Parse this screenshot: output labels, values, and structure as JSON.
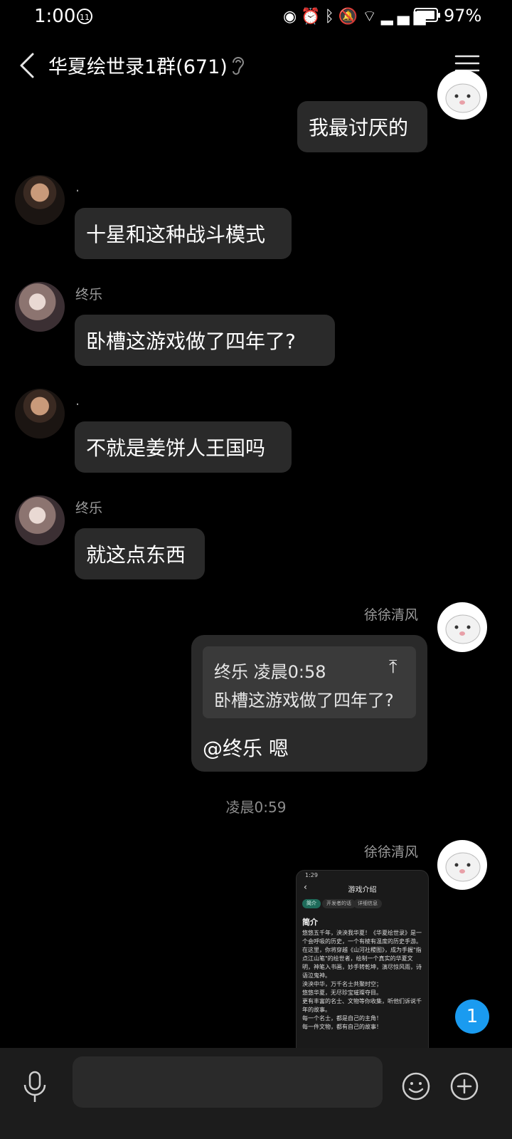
{
  "status_bar": {
    "time": "1:00",
    "badge": "11",
    "battery": "97%",
    "battery_level": 0.97
  },
  "header": {
    "title": "华夏绘世录1群(671)"
  },
  "messages": [
    {
      "side": "right",
      "text": "我最讨厌的"
    },
    {
      "side": "left",
      "sender": ".",
      "text": "十星和这种战斗模式"
    },
    {
      "side": "left",
      "sender": "终乐",
      "text": "卧槽这游戏做了四年了?"
    },
    {
      "side": "left",
      "sender": ".",
      "text": "不就是姜饼人王国吗"
    },
    {
      "side": "left",
      "sender": "终乐",
      "text": "就这点东西"
    },
    {
      "side": "right",
      "sender": "徐徐清风",
      "quote": {
        "author": "终乐",
        "time": "凌晨0:58",
        "text": "卧槽这游戏做了四年了?"
      },
      "text": "@终乐 嗯"
    }
  ],
  "timestamp": "凌晨0:59",
  "image_message": {
    "sender": "徐徐清风",
    "screenshot": {
      "status_time": "1:29",
      "title": "游戏介绍",
      "tabs": [
        "简介",
        "开发者的话",
        "详细信息"
      ],
      "heading": "简介",
      "body": "悠悠五千年，泱泱我华夏！《华夏绘世录》是一个会呼吸的历史，一个有棱有温度的历史手游。\n在这里，你将穿越《山河社稷图》，成为手握\"指点江山笔\"的绘世者，绘制一个真实的华夏文明，神笔入书画，妙手转乾坤，演尽惊风雨，诗语泣鬼神。\n泱泱中华，万千名士共聚时空；\n悠悠华夏，无尽珍宝璀璨夺目。\n更有丰富的名士、文物等你收集，听他们诉说千年的故事。\n每一个名士，都是自己的主角！\n每一件文物，都有自己的故事！"
    }
  },
  "unread_count": "1",
  "input": {
    "placeholder": ""
  }
}
